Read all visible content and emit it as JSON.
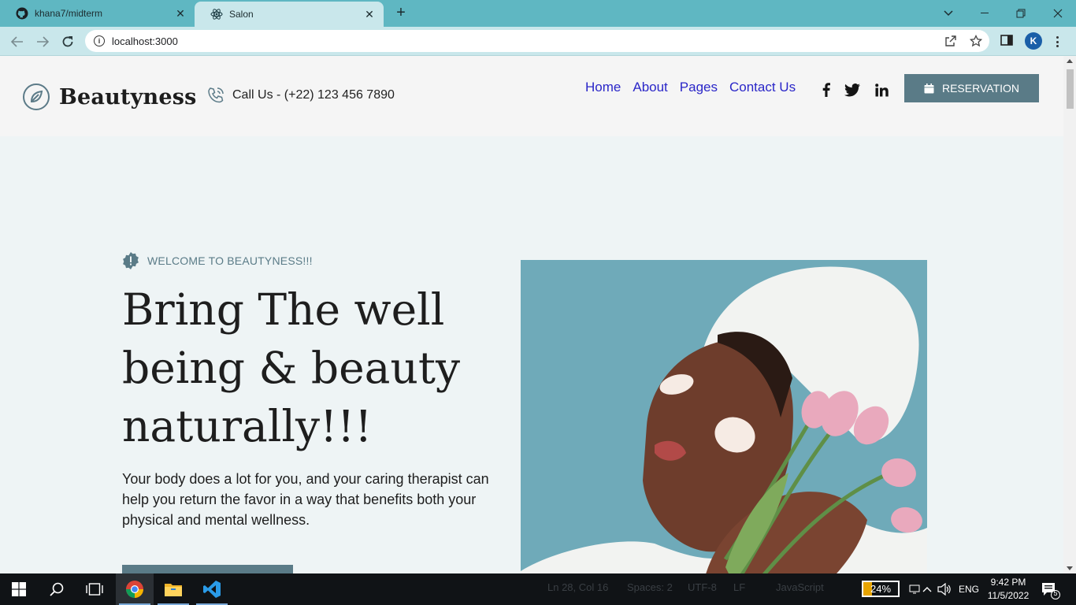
{
  "browser": {
    "tabs": [
      {
        "title": "khana7/midterm",
        "favicon": "github-icon",
        "active": false
      },
      {
        "title": "Salon",
        "favicon": "react-icon",
        "active": true
      }
    ],
    "new_tab_label": "+",
    "url": "localhost:3000",
    "profile_initial": "K",
    "colors": {
      "tab_bar": "#5fb7c2",
      "toolbar": "#c9e7eb"
    }
  },
  "site": {
    "logo_text": "Beautyness",
    "call_text": "Call Us - (+22) 123 456 7890",
    "nav": [
      "Home",
      "About",
      "Pages",
      "Contact Us"
    ],
    "social": [
      "facebook-icon",
      "twitter-icon",
      "linkedin-icon"
    ],
    "reservation_label": "RESERVATION",
    "welcome": "WELCOME TO BEAUTYNESS!!!",
    "hero_title": "Bring The well being & beauty naturally!!!",
    "hero_text": "Your body does a lot for you, and your caring therapist can help you return the favor in a way that benefits both your physical and mental wellness.",
    "colors": {
      "accent": "#5a7b87",
      "nav_link": "#2a26c8",
      "background": "#eef4f5",
      "header": "#f5f5f5"
    }
  },
  "taskbar": {
    "apps": [
      "windows-start-icon",
      "search-icon",
      "task-view-icon",
      "chrome-icon",
      "file-explorer-icon",
      "vscode-icon"
    ],
    "ghost_status": [
      "Ln 28, Col 16",
      "Spaces: 2",
      "UTF-8",
      "LF",
      "JavaScript"
    ],
    "battery_percent": "24%",
    "battery_level": 0.24,
    "language": "ENG",
    "time": "9:42 PM",
    "date": "11/5/2022",
    "notification_count": "5"
  }
}
